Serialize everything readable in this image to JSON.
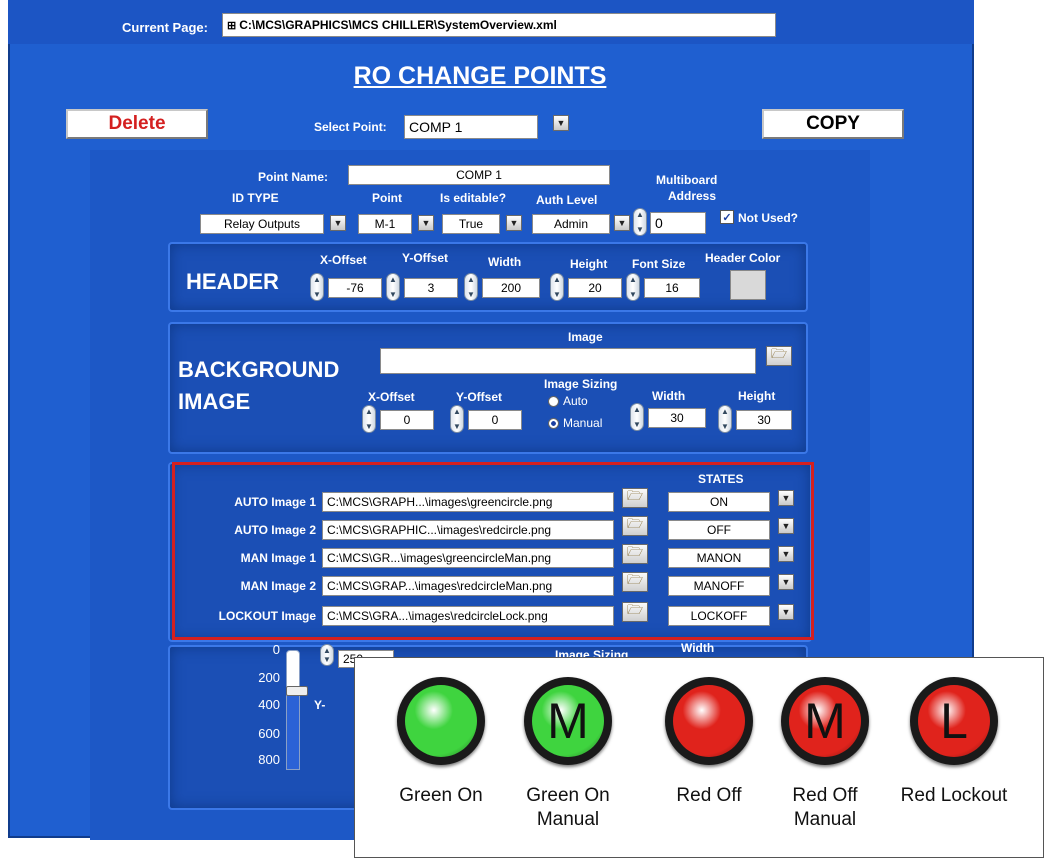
{
  "current_page": {
    "label": "Current Page:",
    "value": "C:\\MCS\\GRAPHICS\\MCS CHILLER\\SystemOverview.xml"
  },
  "title": "RO CHANGE POINTS",
  "delete_label": "Delete",
  "copy_label": "COPY",
  "select_point": {
    "label": "Select Point:",
    "value": "COMP 1"
  },
  "point_name": {
    "label": "Point Name:",
    "value": "COMP 1"
  },
  "id_type": {
    "label": "ID TYPE",
    "value": "Relay Outputs"
  },
  "point": {
    "label": "Point",
    "value": "M-1"
  },
  "is_editable": {
    "label": "Is editable?",
    "value": "True"
  },
  "auth_level": {
    "label": "Auth Level",
    "value": "Admin"
  },
  "multiboard": {
    "label1": "Multiboard",
    "label2": "Address",
    "value": "0"
  },
  "not_used": {
    "label": "Not Used?",
    "checked": true
  },
  "header": {
    "title": "HEADER",
    "x_offset": {
      "label": "X-Offset",
      "value": "-76"
    },
    "y_offset": {
      "label": "Y-Offset",
      "value": "3"
    },
    "width": {
      "label": "Width",
      "value": "200"
    },
    "height": {
      "label": "Height",
      "value": "20"
    },
    "font_size": {
      "label": "Font Size",
      "value": "16"
    },
    "header_color": {
      "label": "Header Color",
      "color": "#d9d9d9"
    }
  },
  "background": {
    "title1": "BACKGROUND",
    "title2": "IMAGE",
    "image_label": "Image",
    "image_value": "",
    "x_offset": {
      "label": "X-Offset",
      "value": "0"
    },
    "y_offset": {
      "label": "Y-Offset",
      "value": "0"
    },
    "image_sizing": {
      "label": "Image Sizing",
      "options": [
        "Auto",
        "Manual"
      ],
      "selected": "Manual"
    },
    "width": {
      "label": "Width",
      "value": "30"
    },
    "height": {
      "label": "Height",
      "value": "30"
    }
  },
  "states_header": "STATES",
  "image_rows": [
    {
      "label": "AUTO Image 1",
      "path": "C:\\MCS\\GRAPH...\\images\\greencircle.png",
      "state": "ON"
    },
    {
      "label": "AUTO Image 2",
      "path": "C:\\MCS\\GRAPHIC...\\images\\redcircle.png",
      "state": "OFF"
    },
    {
      "label": "MAN Image 1",
      "path": "C:\\MCS\\GR...\\images\\greencircleMan.png",
      "state": "MANON"
    },
    {
      "label": "MAN Image 2",
      "path": "C:\\MCS\\GRAP...\\images\\redcircleMan.png",
      "state": "MANOFF"
    },
    {
      "label": "LOCKOUT Image",
      "path": "C:\\MCS\\GRA...\\images\\redcircleLock.png",
      "state": "LOCKOFF"
    }
  ],
  "lower_partial": {
    "slider_ticks": [
      "0",
      "200",
      "400",
      "600",
      "800"
    ],
    "spin_value": "250",
    "image_sizing_label": "Image Sizing",
    "width_label": "Width",
    "y_label": "Y-"
  },
  "legend": {
    "items": [
      {
        "symbol": "",
        "caption1": "Green On",
        "caption2": "",
        "color": "#3fd43f"
      },
      {
        "symbol": "M",
        "caption1": "Green On",
        "caption2": "Manual",
        "color": "#3fd43f"
      },
      {
        "symbol": "",
        "caption1": "Red Off",
        "caption2": "",
        "color": "#e0231c"
      },
      {
        "symbol": "M",
        "caption1": "Red Off",
        "caption2": "Manual",
        "color": "#e0231c"
      },
      {
        "symbol": "L",
        "caption1": "Red Lockout",
        "caption2": "",
        "color": "#e0231c"
      }
    ]
  },
  "colors": {
    "window_blue": "#1f5fd0",
    "highlight_red": "#d42020",
    "delete_red": "#d42020"
  }
}
